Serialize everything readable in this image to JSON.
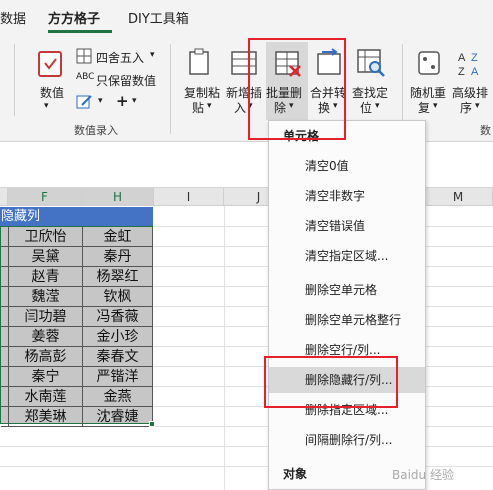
{
  "tabs": [
    {
      "label": "数据",
      "active": false
    },
    {
      "label": "方方格子",
      "active": true
    },
    {
      "label": "DIY工具箱",
      "active": false
    }
  ],
  "ribbon": {
    "number_btn": "数值",
    "four_round": "四舍五入",
    "keep_numeric": "只保留数值",
    "group_number_input": "数值录入",
    "copy_paste": [
      "复制粘",
      "贴"
    ],
    "new_insert": [
      "新增插",
      "入"
    ],
    "batch_delete": [
      "批量删",
      "除"
    ],
    "merge_convert": [
      "合并转",
      "换"
    ],
    "find_locate": [
      "查找定",
      "位"
    ],
    "random_repeat": [
      "随机重",
      "复"
    ],
    "advanced_sort": [
      "高级排",
      "序"
    ],
    "group_cut": "数"
  },
  "columns": [
    "F",
    "H",
    "I",
    "J",
    "M"
  ],
  "sheet": {
    "header": "隐藏列",
    "rows": [
      [
        "卫欣怡",
        "金虹"
      ],
      [
        "吴黛",
        "秦丹"
      ],
      [
        "赵青",
        "杨翠红"
      ],
      [
        "魏滢",
        "钦枫"
      ],
      [
        "闫功碧",
        "冯香薇"
      ],
      [
        "姜蓉",
        "金小珍"
      ],
      [
        "杨高彭",
        "秦春文"
      ],
      [
        "秦宁",
        "严锴洋"
      ],
      [
        "水南莲",
        "金燕"
      ],
      [
        "郑美琳",
        "沈睿婕"
      ]
    ]
  },
  "menu": {
    "section_cell": "单元格",
    "section_object": "对象",
    "items": [
      "清空0值",
      "清空非数字",
      "清空错误值",
      "清空指定区域...",
      "删除空单元格",
      "删除空单元格整行",
      "删除空行/列...",
      "删除隐藏行/列...",
      "删除指定区域...",
      "间隔删除行/列..."
    ],
    "highlighted_index": 7
  },
  "colors": {
    "accent": "#217346",
    "highlight_box": "#e8202a",
    "header_fill": "#4472c4"
  }
}
